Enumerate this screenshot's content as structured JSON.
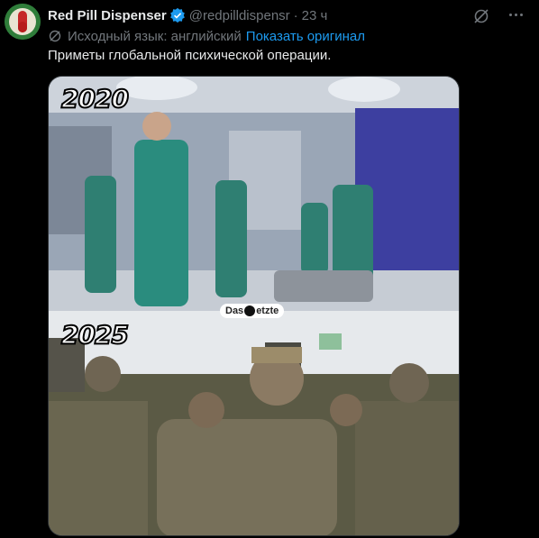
{
  "author": {
    "name": "Red Pill Dispenser",
    "handle": "@redpilldispensr",
    "time": "23 ч"
  },
  "translation": {
    "note": "Исходный язык: английский",
    "show_original": "Показать оригинал"
  },
  "tweet_text": "Приметы глобальной психической операции.",
  "media": {
    "label_top": "2020",
    "label_bottom": "2025",
    "watermark_left": "Das",
    "watermark_right": "etzte"
  },
  "icons": {
    "verified": "verified-badge-icon",
    "grok": "grok-icon",
    "more": "more-icon",
    "translate": "translate-icon"
  },
  "colors": {
    "background": "#000000",
    "text": "#e7e9ea",
    "secondary": "#71767b",
    "link": "#1d9bf0",
    "verified": "#1d9bf0"
  }
}
